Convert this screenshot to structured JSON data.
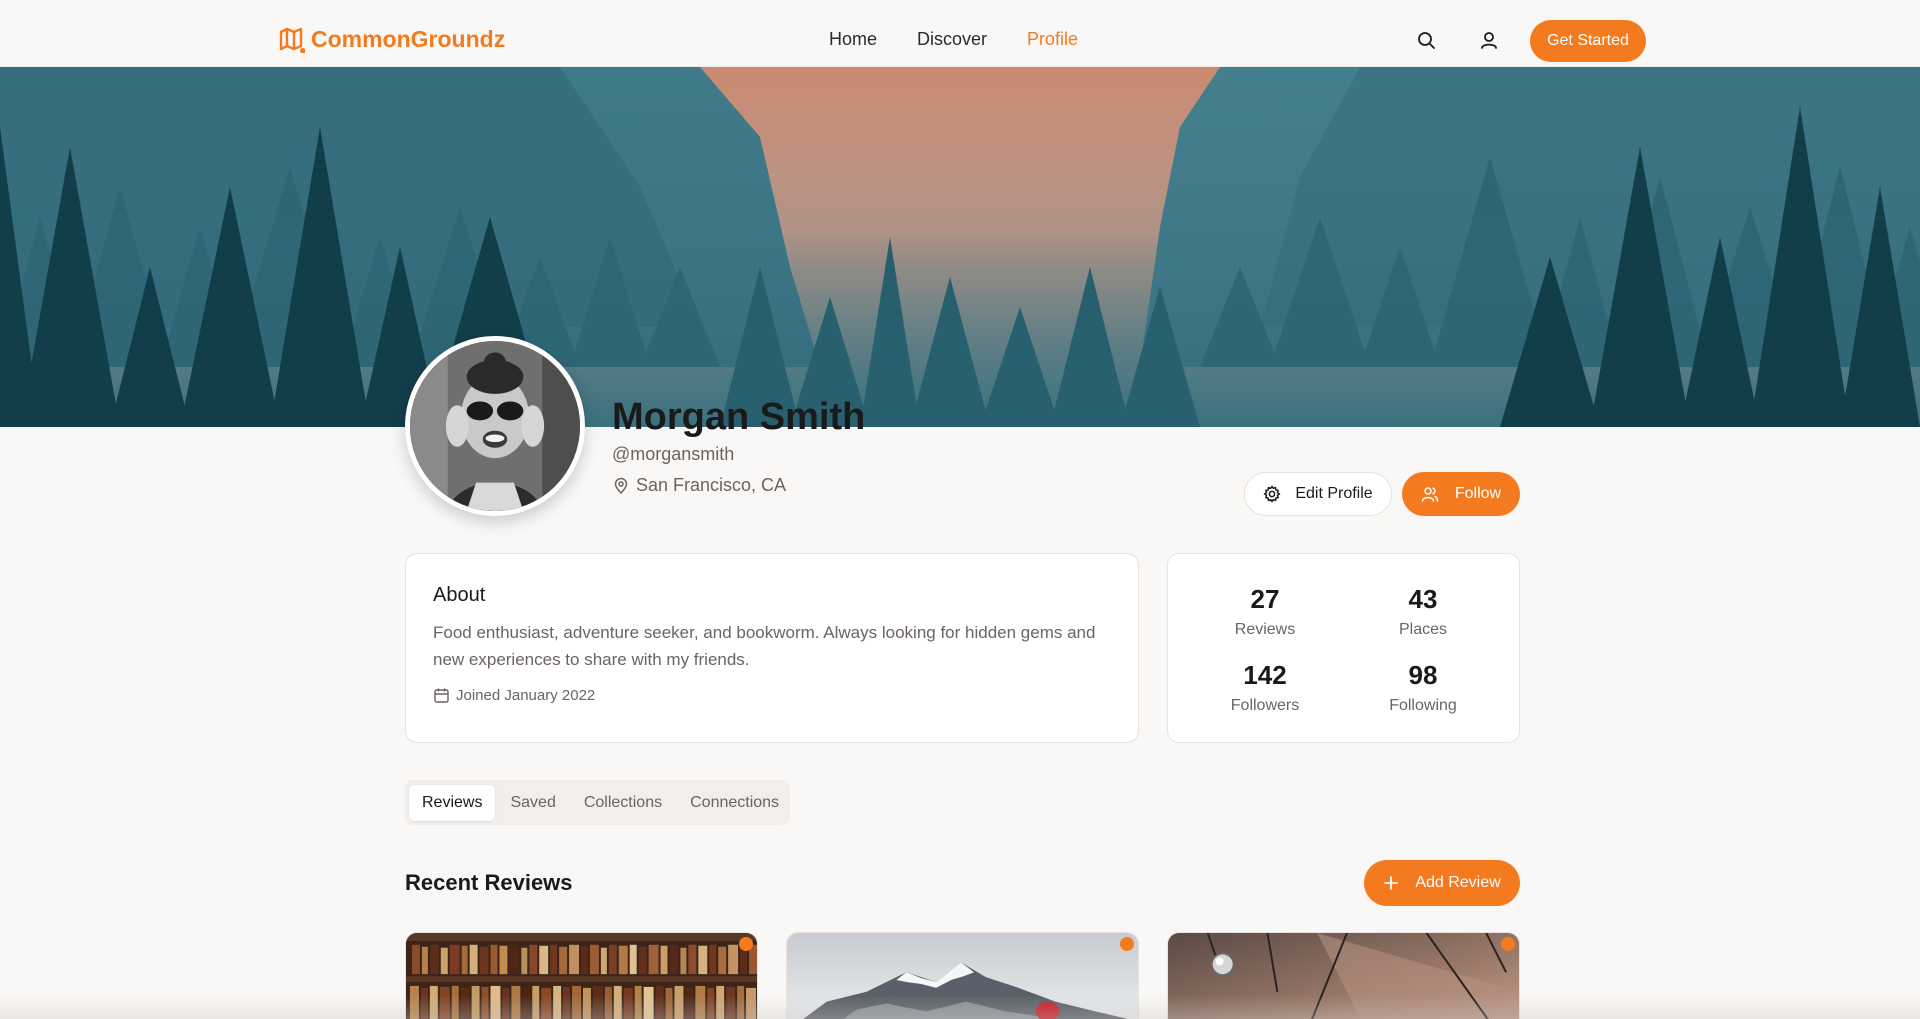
{
  "nav": {
    "brand": "CommonGroundz",
    "links": [
      {
        "label": "Home",
        "active": false
      },
      {
        "label": "Discover",
        "active": false
      },
      {
        "label": "Profile",
        "active": true
      }
    ],
    "cta": "Get Started",
    "icons": [
      "search-icon",
      "user-icon"
    ]
  },
  "profile": {
    "name": "Morgan Smith",
    "handle": "@morgansmith",
    "location": "San Francisco, CA",
    "edit_label": "Edit Profile",
    "follow_label": "Follow"
  },
  "about": {
    "title": "About",
    "text": "Food enthusiast, adventure seeker, and bookworm. Always looking for hidden gems and new experiences to share with my friends.",
    "joined": "Joined January 2022"
  },
  "stats": [
    {
      "value": "27",
      "label": "Reviews"
    },
    {
      "value": "43",
      "label": "Places"
    },
    {
      "value": "142",
      "label": "Followers"
    },
    {
      "value": "98",
      "label": "Following"
    }
  ],
  "tabs": [
    {
      "label": "Reviews",
      "active": true
    },
    {
      "label": "Saved",
      "active": false
    },
    {
      "label": "Collections",
      "active": false
    },
    {
      "label": "Connections",
      "active": false
    }
  ],
  "recent": {
    "title": "Recent Reviews",
    "add_label": "Add Review"
  },
  "colors": {
    "accent": "#f47a1f",
    "background": "#faf8f6",
    "muted_text": "#6b6461"
  }
}
